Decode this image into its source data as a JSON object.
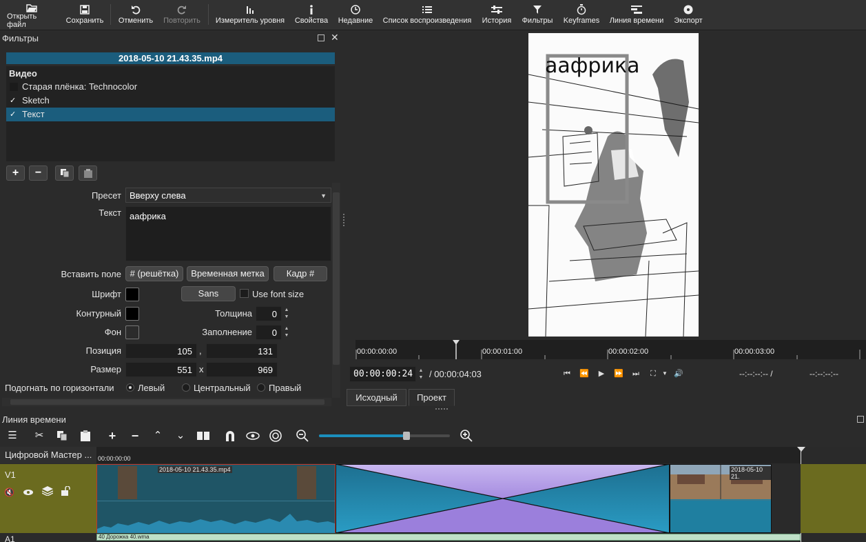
{
  "toolbar": {
    "open": "Открыть файл",
    "save": "Сохранить",
    "undo": "Отменить",
    "redo": "Повторить",
    "meter": "Измеритель уровня",
    "properties": "Свойства",
    "recent": "Недавние",
    "playlist": "Список воспроизведения",
    "history": "История",
    "filters": "Фильтры",
    "keyframes": "Keyframes",
    "timeline": "Линия времени",
    "export": "Экспорт"
  },
  "filters": {
    "title": "Фильтры",
    "clip_name": "2018-05-10 21.43.35.mp4",
    "section": "Видео",
    "items": [
      {
        "label": "Старая плёнка: Technocolor",
        "checked": false
      },
      {
        "label": "Sketch",
        "checked": true
      },
      {
        "label": "Текст",
        "checked": true
      }
    ],
    "check_mark": "✓"
  },
  "props": {
    "preset_label": "Пресет",
    "preset_value": "Вверху слева",
    "text_label": "Текст",
    "text_value": "аафрика",
    "insert_label": "Вставить поле",
    "insert_hash": "# (решётка)",
    "insert_time": "Временная метка",
    "insert_frame": "Кадр #",
    "font_label": "Шрифт",
    "font_color": "#000000",
    "font_name": "Sans",
    "use_font_size": "Use font size",
    "outline_label": "Контурный",
    "outline_color": "#000000",
    "thickness_label": "Толщина",
    "thickness_value": "0",
    "bg_label": "Фон",
    "bg_color": "#2b2b2b",
    "padding_label": "Заполнение",
    "padding_value": "0",
    "position_label": "Позиция",
    "pos_x": "105",
    "pos_sep": ",",
    "pos_y": "131",
    "size_label": "Размер",
    "size_w": "551",
    "size_sep": "x",
    "size_h": "969",
    "halign_label": "Подогнать по горизонтали",
    "align_left": "Левый",
    "align_center": "Центральный",
    "align_right": "Правый"
  },
  "player": {
    "overlay_text": "аафрика",
    "ruler": [
      "00:00:00:00",
      "00:00:01:00",
      "00:00:02:00",
      "00:00:03:00"
    ],
    "position": "00:00:00:24",
    "duration": "/ 00:00:04:03",
    "in_point": "--:--:--:-- /",
    "out_point": "--:--:--:--",
    "tab_source": "Исходный",
    "tab_project": "Проект"
  },
  "timeline": {
    "title": "Линия времени",
    "master": "Цифровой Мастер ...",
    "start_tc": "00:00:00:00",
    "track_v1": "V1",
    "clip1": "2018-05-10 21.43.35.mp4",
    "clip2": "2018-05-10 21.",
    "audio_clip": "40 Дорожка 40.wma",
    "track_a1": "A1",
    "zoom_level": 0.67
  }
}
